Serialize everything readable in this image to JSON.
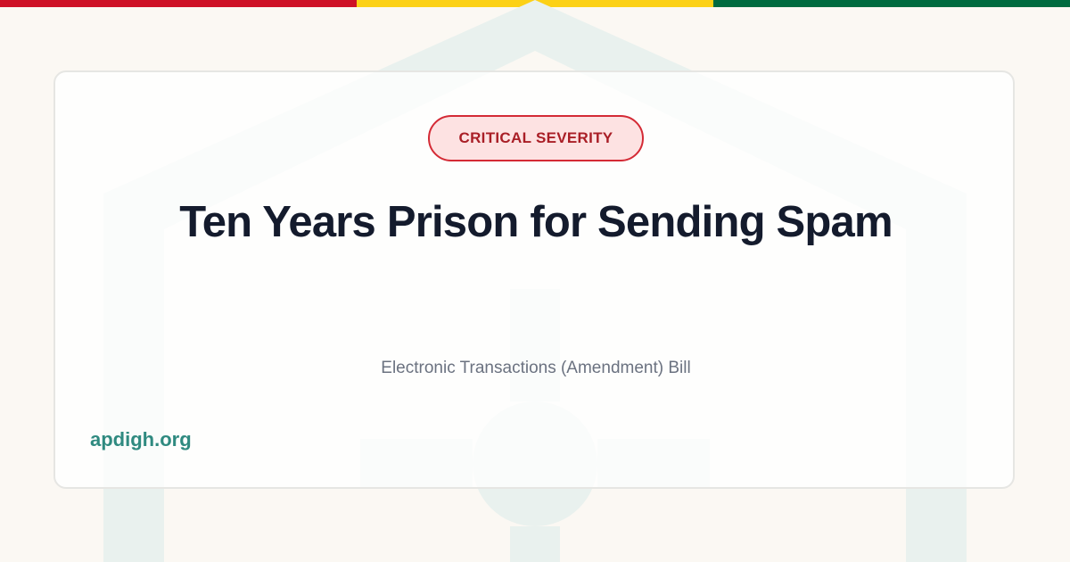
{
  "colors": {
    "flag_red": "#ce1126",
    "flag_gold": "#fcd116",
    "flag_green": "#006b3f",
    "emblem": "#e9f1ee",
    "badge_border": "#d42a35",
    "badge_fill": "#fde2e2",
    "badge_text": "#a91e26",
    "title_text": "#141b2d",
    "subtitle_text": "#6b7280",
    "site_text": "#2f8a80"
  },
  "badge": {
    "label": "CRITICAL SEVERITY"
  },
  "headline": "Ten Years Prison for Sending Spam",
  "bill": "Electronic Transactions (Amendment) Bill",
  "site": "apdigh.org",
  "icons": {
    "background": "shield-emblem-icon"
  }
}
